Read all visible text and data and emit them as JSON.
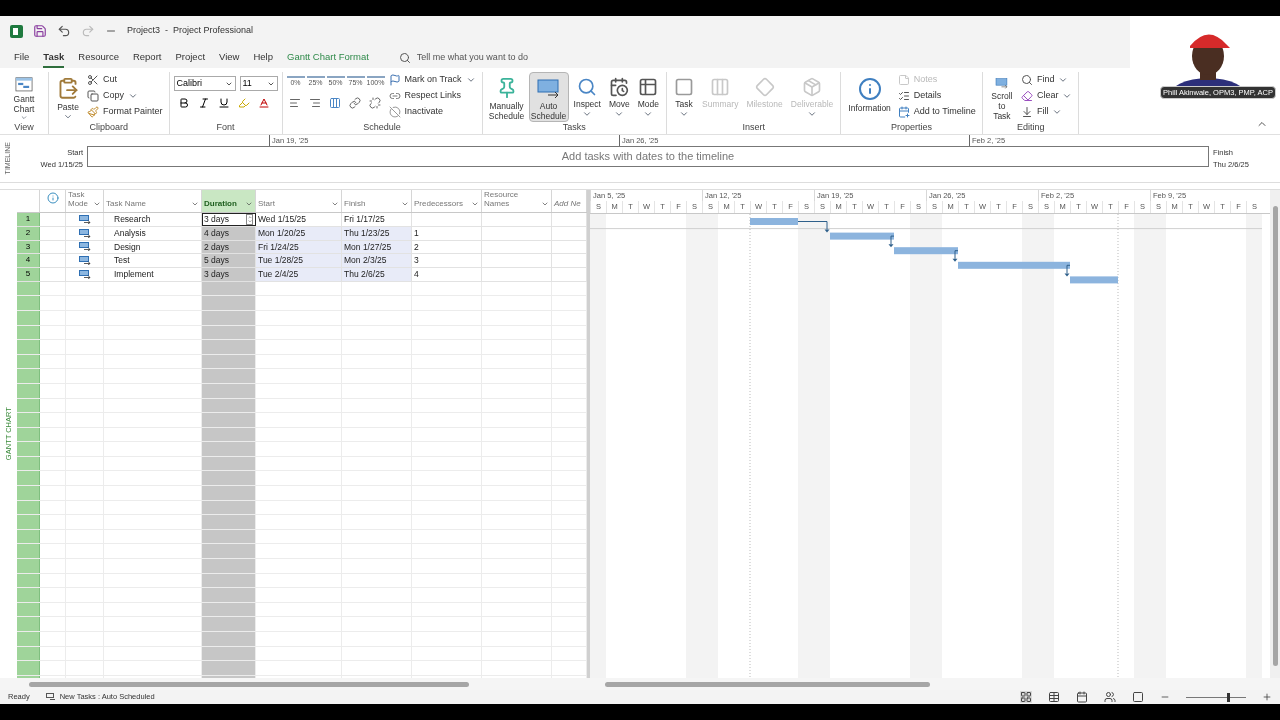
{
  "window": {
    "title": "Project3  -  Project Professional"
  },
  "menu_tabs": [
    {
      "label": "File",
      "selected": false,
      "kind": "plain"
    },
    {
      "label": "Task",
      "selected": true,
      "kind": "plain"
    },
    {
      "label": "Resource",
      "selected": false,
      "kind": "plain"
    },
    {
      "label": "Report",
      "selected": false,
      "kind": "plain"
    },
    {
      "label": "Project",
      "selected": false,
      "kind": "plain"
    },
    {
      "label": "View",
      "selected": false,
      "kind": "plain"
    },
    {
      "label": "Help",
      "selected": false,
      "kind": "plain"
    },
    {
      "label": "Gantt Chart Format",
      "selected": false,
      "kind": "contextual"
    }
  ],
  "tell_me": {
    "placeholder": "Tell me what you want to do"
  },
  "ribbon": {
    "view": {
      "label": "View",
      "gantt": {
        "label": "Gantt Chart",
        "dropdown": true
      }
    },
    "clipboard": {
      "label": "Clipboard",
      "paste": {
        "label": "Paste",
        "dropdown": true
      },
      "items": [
        {
          "label": "Cut",
          "dropdown": false
        },
        {
          "label": "Copy",
          "dropdown": true
        },
        {
          "label": "Format Painter",
          "dropdown": false
        }
      ]
    },
    "font": {
      "label": "Font",
      "family": "Calibri",
      "size": "11"
    },
    "schedule": {
      "label": "Schedule",
      "percents": [
        "0%",
        "25%",
        "50%",
        "75%",
        "100%"
      ],
      "items": [
        {
          "label": "Mark on Track",
          "dropdown": true
        },
        {
          "label": "Respect Links",
          "dropdown": false
        },
        {
          "label": "Inactivate",
          "dropdown": false
        }
      ]
    },
    "tasks": {
      "label": "Tasks",
      "items": [
        {
          "label": "Manually Schedule",
          "selected": false,
          "dropdown": false
        },
        {
          "label": "Auto Schedule",
          "selected": true,
          "dropdown": false
        },
        {
          "label": "Inspect",
          "selected": false,
          "dropdown": true
        },
        {
          "label": "Move",
          "selected": false,
          "dropdown": true
        },
        {
          "label": "Mode",
          "selected": false,
          "dropdown": true
        }
      ]
    },
    "insert": {
      "label": "Insert",
      "items": [
        {
          "label": "Task",
          "disabled": false,
          "dropdown": true
        },
        {
          "label": "Summary",
          "disabled": true,
          "dropdown": false
        },
        {
          "label": "Milestone",
          "disabled": true,
          "dropdown": false
        },
        {
          "label": "Deliverable",
          "disabled": true,
          "dropdown": true
        }
      ]
    },
    "properties": {
      "label": "Properties",
      "information": {
        "label": "Information"
      },
      "items": [
        {
          "label": "Notes",
          "disabled": true
        },
        {
          "label": "Details",
          "disabled": false
        },
        {
          "label": "Add to Timeline",
          "disabled": false
        }
      ]
    },
    "editing": {
      "label": "Editing",
      "scroll": {
        "label": "Scroll to Task"
      },
      "items": [
        {
          "label": "Find",
          "dropdown": true
        },
        {
          "label": "Clear",
          "dropdown": true
        },
        {
          "label": "Fill",
          "dropdown": true
        }
      ]
    }
  },
  "timeline": {
    "label": "TIMELINE",
    "start_label": "Start",
    "start_date": "Wed 1/15/25",
    "finish_label": "Finish",
    "finish_date": "Thu 2/6/25",
    "placeholder": "Add tasks with dates to the timeline",
    "ticks": [
      "Jan 19, '25",
      "Jan 26, '25",
      "Feb 2, '25"
    ]
  },
  "view_label": "GANTT CHART",
  "table": {
    "columns": [
      {
        "kind": "info",
        "selected": false
      },
      {
        "kind": "text",
        "label": "Task Mode",
        "selected": false
      },
      {
        "kind": "text",
        "label": "Task Name",
        "selected": false
      },
      {
        "kind": "text",
        "label": "Duration",
        "selected": true
      },
      {
        "kind": "text",
        "label": "Start",
        "selected": false
      },
      {
        "kind": "text",
        "label": "Finish",
        "selected": false
      },
      {
        "kind": "text",
        "label": "Predecessors",
        "selected": false
      },
      {
        "kind": "text",
        "label": "Resource Names",
        "selected": false
      },
      {
        "kind": "add",
        "label": "Add Ne",
        "selected": false
      }
    ],
    "rows": [
      {
        "id": "1",
        "name": "Research",
        "duration": "3 days",
        "start": "Wed 1/15/25",
        "finish": "Fri 1/17/25",
        "predecessors": "",
        "editing": true,
        "changed": false
      },
      {
        "id": "2",
        "name": "Analysis",
        "duration": "4 days",
        "start": "Mon 1/20/25",
        "finish": "Thu 1/23/25",
        "predecessors": "1",
        "editing": false,
        "changed": true
      },
      {
        "id": "3",
        "name": "Design",
        "duration": "2 days",
        "start": "Fri 1/24/25",
        "finish": "Mon 1/27/25",
        "predecessors": "2",
        "editing": false,
        "changed": true
      },
      {
        "id": "4",
        "name": "Test",
        "duration": "5 days",
        "start": "Tue 1/28/25",
        "finish": "Mon 2/3/25",
        "predecessors": "3",
        "editing": false,
        "changed": true
      },
      {
        "id": "5",
        "name": "Implement",
        "duration": "3 days",
        "start": "Tue 2/4/25",
        "finish": "Thu 2/6/25",
        "predecessors": "4",
        "editing": false,
        "changed": true
      }
    ]
  },
  "gantt": {
    "weeks": [
      "Jan 5, '25",
      "Jan 12, '25",
      "Jan 19, '25",
      "Jan 26, '25",
      "Feb 2, '25",
      "Feb 9, '25"
    ],
    "days": [
      "S",
      "M",
      "T",
      "W",
      "T",
      "F",
      "S",
      "S",
      "M",
      "T",
      "W",
      "T",
      "F",
      "S",
      "S",
      "M",
      "T",
      "W",
      "T",
      "F",
      "S",
      "S",
      "M",
      "T",
      "W",
      "T",
      "F",
      "S",
      "S",
      "M",
      "T",
      "W",
      "T",
      "F",
      "S",
      "S",
      "M",
      "T",
      "W",
      "T",
      "F",
      "S"
    ]
  },
  "status_bar": {
    "ready": "Ready",
    "new_tasks": "New Tasks : Auto Scheduled",
    "zoom": {
      "level": 0.72
    }
  },
  "presenter": {
    "caption": "Phill Akinwale, OPM3, PMP, ACP"
  }
}
